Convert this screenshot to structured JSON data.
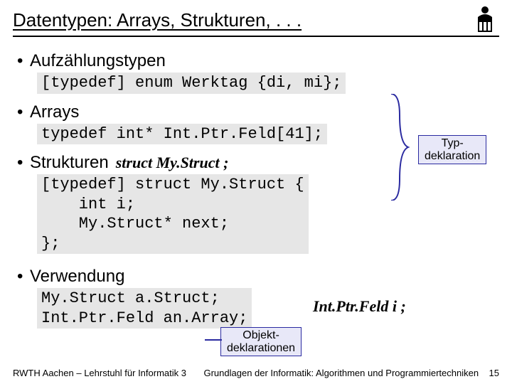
{
  "header": {
    "title": "Datentypen: Arrays, Strukturen, . . ."
  },
  "bullets": {
    "enum": "Aufzählungstypen",
    "arrays": "Arrays",
    "structs": "Strukturen",
    "usage": "Verwendung"
  },
  "code": {
    "enum": "[typedef] enum Werktag {di, mi};",
    "arrays": "typedef int* Int.Ptr.Feld[41];",
    "structs": "[typedef] struct My.Struct {\n    int i;\n    My.Struct* next;\n};",
    "usage": "My.Struct a.Struct;\nInt.Ptr.Feld an.Array;"
  },
  "handwritten": {
    "struct_inline": "struct My.Struct ;",
    "usage_inline": "Int.Ptr.Feld  i ;"
  },
  "labels": {
    "typedecl_line1": "Typ-",
    "typedecl_line2": "deklaration",
    "objdecl_line1": "Objekt-",
    "objdecl_line2": "deklarationen"
  },
  "footer": {
    "left": "RWTH Aachen – Lehrstuhl für Informatik 3",
    "right": "Grundlagen der Informatik: Algorithmen und Programmiertechniken",
    "page": "15"
  }
}
